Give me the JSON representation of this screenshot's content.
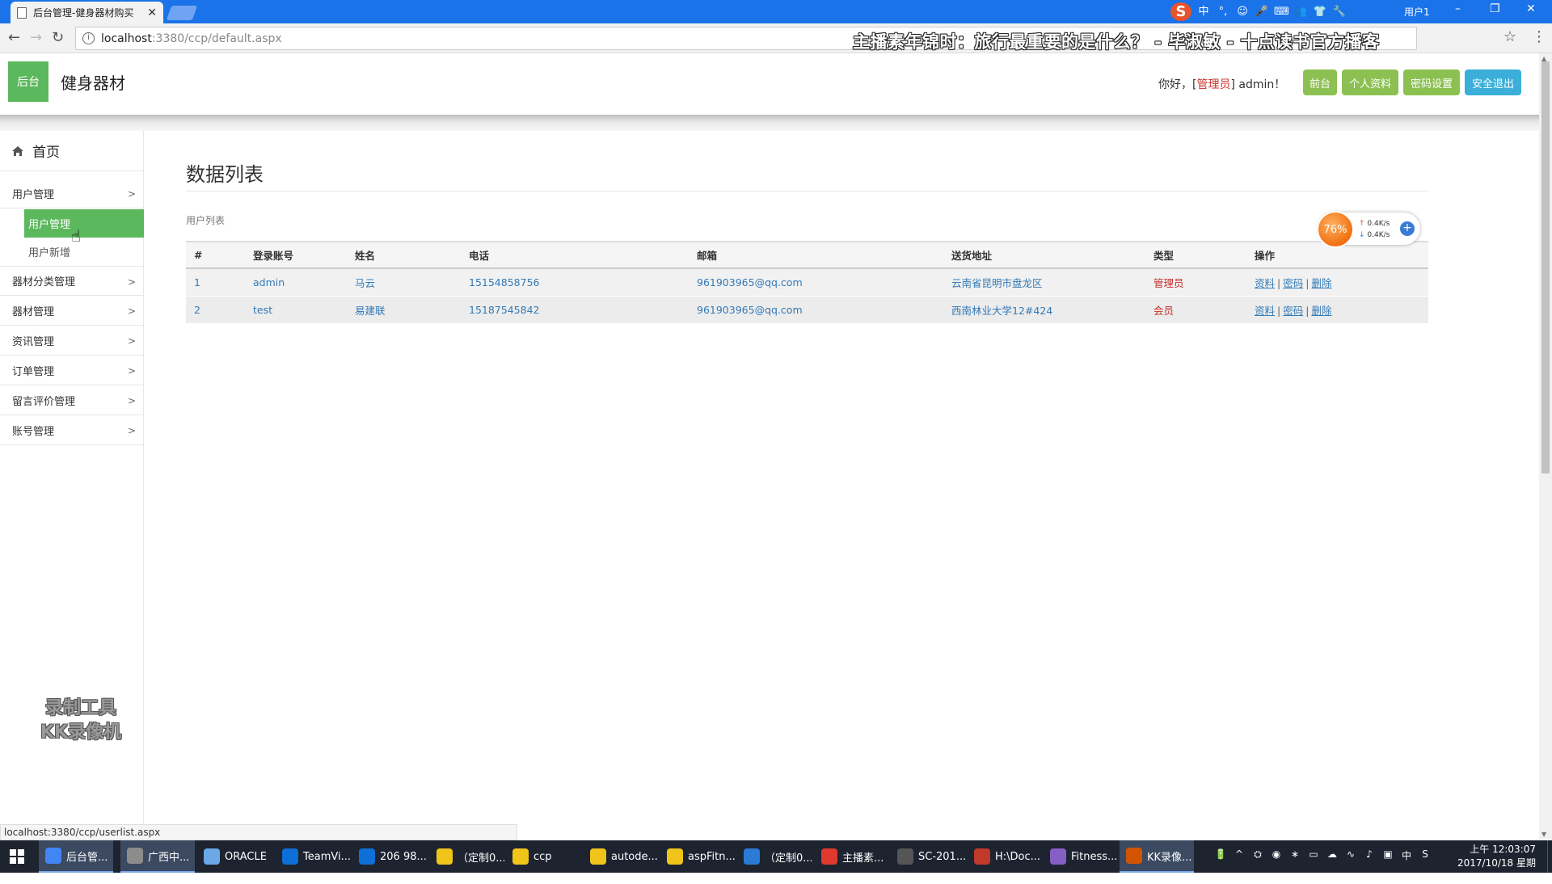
{
  "browser": {
    "tab_title": "后台管理-健身器材购买",
    "tab_close": "✕",
    "url_host": "localhost",
    "url_path": ":3380/ccp/default.aspx",
    "overlay_caption": "主播素年锦时：旅行最重要的是什么？ - 毕淑敏 - 十点读书官方播客",
    "user_label": "用户1",
    "ime_items": [
      "中",
      "°,",
      "☺",
      "🎤",
      "⌨",
      "👥",
      "👕",
      "🔧"
    ],
    "status_url": "localhost:3380/ccp/userlist.aspx"
  },
  "header": {
    "logo_text": "后台",
    "site_title": "健身器材",
    "greeting_prefix": "你好，[",
    "greeting_role": "管理员",
    "greeting_suffix": "] admin！",
    "buttons": {
      "front": "前台",
      "profile": "个人资料",
      "password": "密码设置",
      "logout": "安全退出"
    },
    "colors": {
      "green": "#8cc152",
      "blue": "#3bafda",
      "logo": "#5cb85c"
    }
  },
  "sidebar": {
    "home": "首页",
    "groups": [
      {
        "label": "用户管理",
        "chevron": ">"
      },
      {
        "label": "器材分类管理",
        "chevron": ">"
      },
      {
        "label": "器材管理",
        "chevron": ">"
      },
      {
        "label": "资讯管理",
        "chevron": ">"
      },
      {
        "label": "订单管理",
        "chevron": ">"
      },
      {
        "label": "留言评价管理",
        "chevron": ">"
      },
      {
        "label": "账号管理",
        "chevron": ">"
      }
    ],
    "sub_items": [
      {
        "label": "用户管理",
        "active": true
      },
      {
        "label": "用户新增",
        "active": false
      }
    ]
  },
  "main": {
    "title": "数据列表",
    "section": "用户列表",
    "columns": [
      "#",
      "登录账号",
      "姓名",
      "电话",
      "邮箱",
      "送货地址",
      "类型",
      "操作"
    ],
    "rows": [
      {
        "no": "1",
        "account": "admin",
        "name": "马云",
        "phone": "15154858756",
        "email": "961903965@qq.com",
        "address": "云南省昆明市盘龙区",
        "type": "管理员"
      },
      {
        "no": "2",
        "account": "test",
        "name": "易建联",
        "phone": "15187545842",
        "email": "961903965@qq.com",
        "address": "西南林业大学12#424",
        "type": "会员"
      }
    ],
    "actions": {
      "info": "资料",
      "password": "密码",
      "delete": "删除",
      "sep": "|"
    }
  },
  "speed_widget": {
    "percent": "76%",
    "up": "0.4K/s",
    "down": "0.4K/s",
    "plus": "+"
  },
  "watermark": {
    "line1": "录制工具",
    "line2": "KK录像机"
  },
  "taskbar": {
    "items": [
      {
        "label": "后台管...",
        "color": "#4285f4",
        "active": true
      },
      {
        "label": "广西中...",
        "color": "#8c8c8c",
        "active": true
      },
      {
        "label": "ORACLE",
        "color": "#6aa8e8",
        "active": false
      },
      {
        "label": "TeamVi...",
        "color": "#0e6fd8",
        "active": false
      },
      {
        "label": "206 98...",
        "color": "#0e6fd8",
        "active": false
      },
      {
        "label": "（定制0...",
        "color": "#f0c419",
        "active": false
      },
      {
        "label": "ccp",
        "color": "#f0c419",
        "active": false
      },
      {
        "label": "autode...",
        "color": "#f0c419",
        "active": false
      },
      {
        "label": "aspFitn...",
        "color": "#f0c419",
        "active": false
      },
      {
        "label": "（定制0...",
        "color": "#2b7bd6",
        "active": false
      },
      {
        "label": "主播素...",
        "color": "#e03a2f",
        "active": false
      },
      {
        "label": "SC-201...",
        "color": "#555555",
        "active": false
      },
      {
        "label": "H:\\Doc...",
        "color": "#c0392b",
        "active": false
      },
      {
        "label": "Fitness...",
        "color": "#865fc5",
        "active": false
      },
      {
        "label": "KK录像...",
        "color": "#d35400",
        "active": true
      }
    ],
    "tray": [
      "🔋",
      "^",
      "⛭",
      "◉",
      "∗",
      "▭",
      "☁",
      "∿",
      "♪",
      "▣",
      "中",
      "S"
    ],
    "time": "上午 12:03:07",
    "date": "2017/10/18 星期三"
  }
}
